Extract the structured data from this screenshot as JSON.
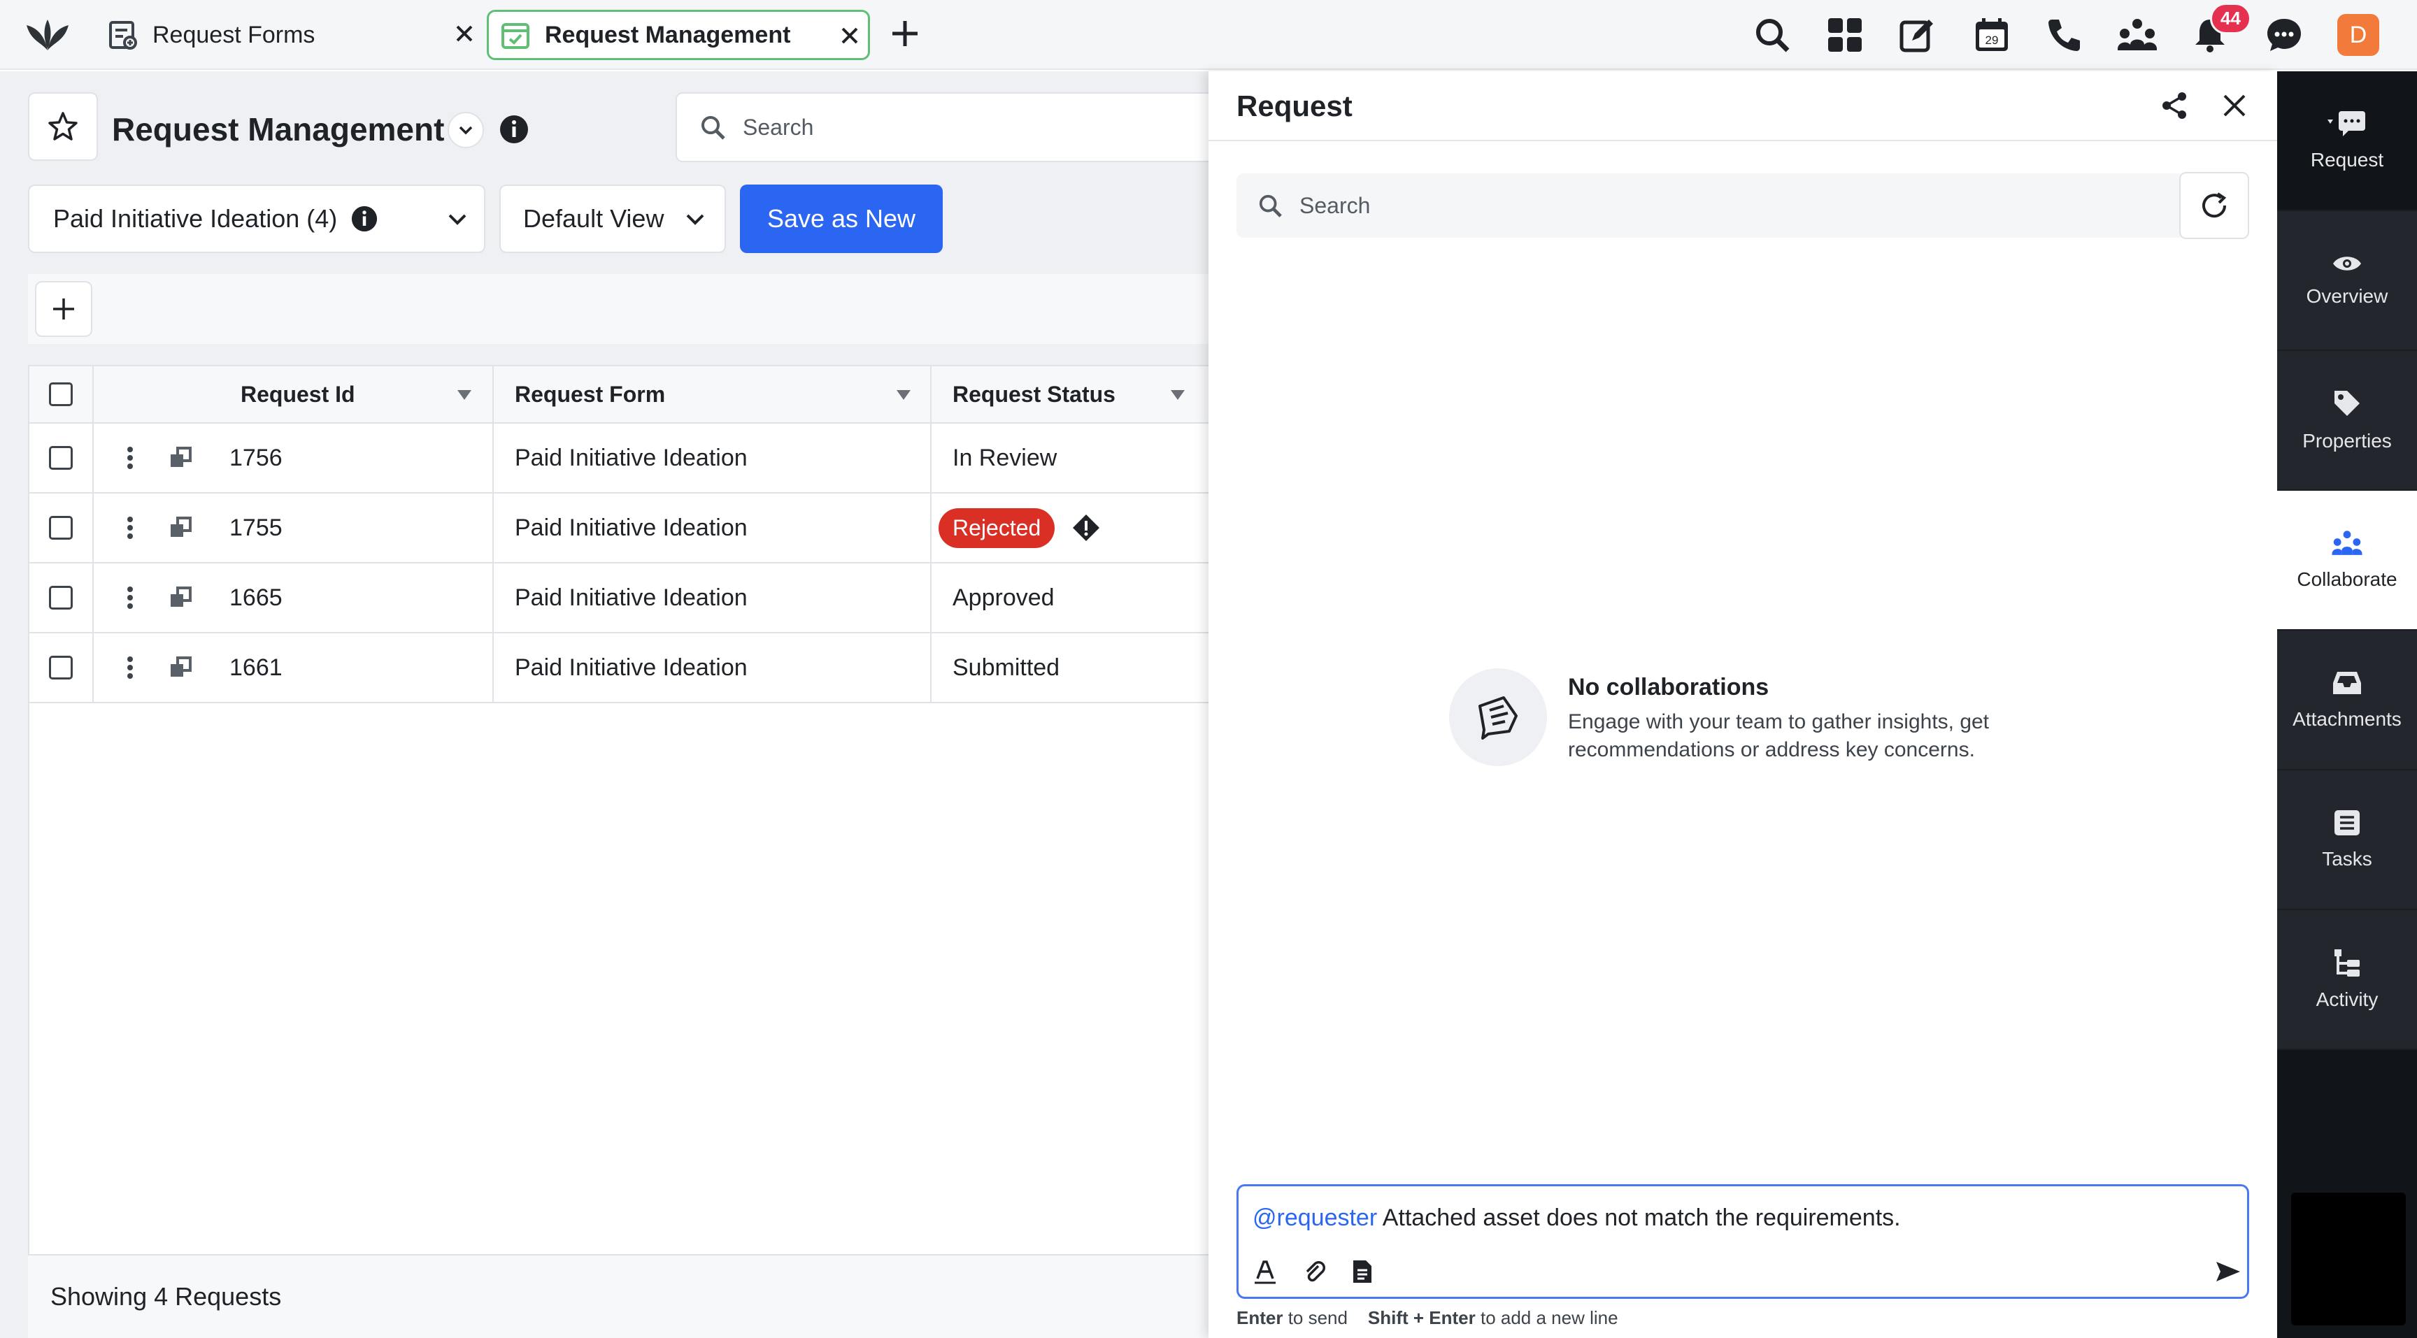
{
  "tabs": [
    {
      "label": "Request Forms"
    },
    {
      "label": "Request Management"
    }
  ],
  "notifications_count": "44",
  "avatar_initial": "D",
  "page": {
    "title": "Request Management",
    "search_placeholder": "Search",
    "view_selector": "Paid Initiative Ideation (4)",
    "default_view": "Default View",
    "save_as_new": "Save as New"
  },
  "table": {
    "columns": [
      "Request Id",
      "Request Form",
      "Request Status"
    ],
    "rows": [
      {
        "id": "1756",
        "form": "Paid Initiative Ideation",
        "status": "In Review"
      },
      {
        "id": "1755",
        "form": "Paid Initiative Ideation",
        "status": "Rejected"
      },
      {
        "id": "1665",
        "form": "Paid Initiative Ideation",
        "status": "Approved"
      },
      {
        "id": "1661",
        "form": "Paid Initiative Ideation",
        "status": "Submitted"
      }
    ],
    "footer": "Showing 4 Requests"
  },
  "panel": {
    "title": "Request",
    "search_placeholder": "Search",
    "empty_title": "No collaborations",
    "empty_line1": "Engage with your team to gather insights, get",
    "empty_line2": "recommendations or address key concerns.",
    "mention": "@requester",
    "message": " Attached asset does not match the requirements.",
    "hint_key1": "Enter",
    "hint_text1": " to send",
    "hint_key2": "Shift + Enter",
    "hint_text2": " to add a new line"
  },
  "rail": [
    {
      "label": "Request"
    },
    {
      "label": "Overview"
    },
    {
      "label": "Properties"
    },
    {
      "label": "Collaborate"
    },
    {
      "label": "Attachments"
    },
    {
      "label": "Tasks"
    },
    {
      "label": "Activity"
    }
  ],
  "colors": {
    "accent": "#2b66f2",
    "rejected": "#d92f25",
    "active_tab_border": "#5fbf74",
    "badge": "#e5304f"
  }
}
